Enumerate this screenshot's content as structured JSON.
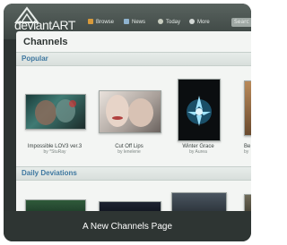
{
  "app": {
    "logo_text": "deviantART"
  },
  "nav": {
    "items": [
      {
        "label": "Browse",
        "icon": "browse-icon"
      },
      {
        "label": "News",
        "icon": "news-icon"
      },
      {
        "label": "Today",
        "icon": "today-icon"
      },
      {
        "label": "More",
        "icon": "more-icon"
      }
    ],
    "search_placeholder": "Searc"
  },
  "page": {
    "title": "Channels",
    "sections": {
      "popular": "Popular",
      "daily": "Daily Deviations"
    }
  },
  "popular_items": [
    {
      "title": "Impossible LOV3 ver.3",
      "byline": "by *StuRay"
    },
    {
      "title": "Cut Off Lips",
      "byline": "by lenelene"
    },
    {
      "title": "Winter Grace",
      "byline": "by Aurea"
    },
    {
      "title": "Be",
      "byline": "by"
    }
  ],
  "caption": "A New Channels Page",
  "colors": {
    "accent": "#3f78a0",
    "topbar": "#4a5451",
    "content_bg": "#f3f5f3"
  }
}
